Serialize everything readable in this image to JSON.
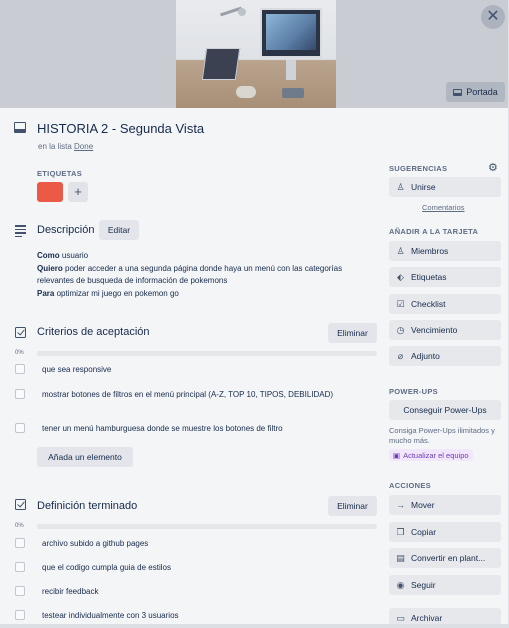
{
  "cover": {
    "close_label": "✕",
    "cover_button": "Portada"
  },
  "card": {
    "title": "HISTORIA 2 - Segunda Vista",
    "list_prefix": "en la lista",
    "list_name": "Done"
  },
  "labels": {
    "heading": "ETIQUETAS",
    "color": "#eb5a46",
    "add": "+"
  },
  "description": {
    "heading": "Descripción",
    "edit": "Editar",
    "lines": [
      {
        "bold": "Como",
        "text": " usuario"
      },
      {
        "bold": "Quiero",
        "text": " poder acceder a una segunda página donde haya un menú con las categorías relevantes de busqueda de información de pokemons"
      },
      {
        "bold": "Para",
        "text": " optimizar mi juego en pokemon go"
      }
    ]
  },
  "checklist1": {
    "title": "Criterios de aceptación",
    "delete": "Eliminar",
    "progress": "0%",
    "progress_value": 0,
    "items": [
      "que sea responsive",
      "mostrar botones de filtros en el menú principal (A-Z, TOP 10, TIPOS, DEBILIDAD)",
      "tener un menú hamburguesa donde se muestre los botones de filtro"
    ],
    "add_item": "Añada un elemento"
  },
  "checklist2": {
    "title": "Definición terminado",
    "delete": "Eliminar",
    "progress": "0%",
    "progress_value": 0,
    "items": [
      "archivo subido a github pages",
      "que el codigo cumpla guia de estilos",
      "recibir feedback",
      "testear individualmente con 3 usuarios"
    ]
  },
  "sidebar": {
    "suggestions_heading": "SUGERENCIAS",
    "join": "Unirse",
    "comments": "Comentarios",
    "add_heading": "AÑADIR A LA TARJETA",
    "members": "Miembros",
    "labels": "Etiquetas",
    "checklist": "Checklist",
    "due": "Vencimiento",
    "attachment": "Adjunto",
    "powerups_heading": "POWER-UPS",
    "get_powerups": "Conseguir Power-Ups",
    "powerups_desc": "Consiga Power-Ups ilimitados y mucho más.",
    "upgrade": "Actualizar el equipo",
    "actions_heading": "ACCIONES",
    "move": "Mover",
    "copy": "Copiar",
    "template": "Convertir en plant...",
    "follow": "Seguir",
    "archive": "Archivar"
  }
}
